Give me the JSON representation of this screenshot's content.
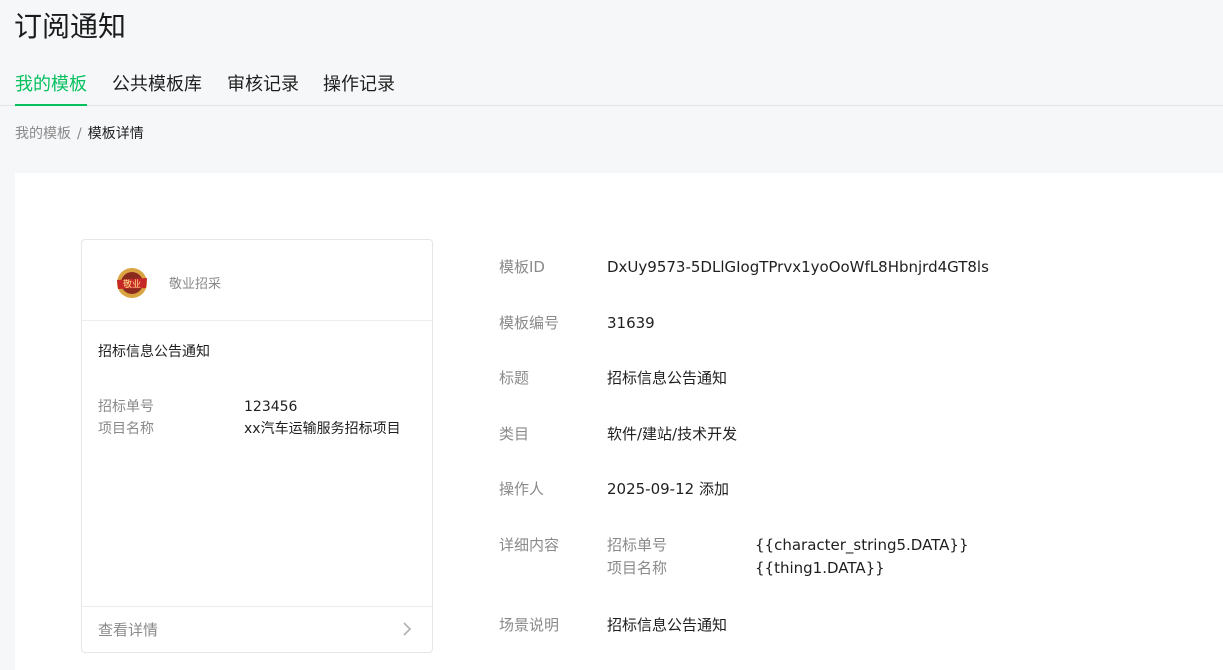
{
  "header": {
    "title": "订阅通知"
  },
  "tabs": [
    {
      "label": "我的模板",
      "active": true
    },
    {
      "label": "公共模板库",
      "active": false
    },
    {
      "label": "审核记录",
      "active": false
    },
    {
      "label": "操作记录",
      "active": false
    }
  ],
  "breadcrumb": {
    "parent": "我的模板",
    "separator": "/",
    "current": "模板详情"
  },
  "preview": {
    "brand_name": "敬业招采",
    "logo_text": "敬业",
    "title": "招标信息公告通知",
    "fields": [
      {
        "key": "招标单号",
        "value": "123456"
      },
      {
        "key": "项目名称",
        "value": "xx汽车运输服务招标项目"
      }
    ],
    "footer_label": "查看详情"
  },
  "details": {
    "template_id": {
      "label": "模板ID",
      "value": "DxUy9573-5DLlGIogTPrvx1yoOoWfL8Hbnjrd4GT8ls"
    },
    "template_no": {
      "label": "模板编号",
      "value": "31639"
    },
    "title": {
      "label": "标题",
      "value": "招标信息公告通知"
    },
    "category": {
      "label": "类目",
      "value": "软件/建站/技术开发"
    },
    "operator": {
      "label": "操作人",
      "value": "2025-09-12 添加"
    },
    "content": {
      "label": "详细内容",
      "items": [
        {
          "key": "招标单号",
          "value": "{{character_string5.DATA}}"
        },
        {
          "key": "项目名称",
          "value": "{{thing1.DATA}}"
        }
      ]
    },
    "scene": {
      "label": "场景说明",
      "value": "招标信息公告通知"
    }
  },
  "colors": {
    "accent": "#07c160",
    "muted": "#8a8a8a",
    "text": "#1f1f1f"
  },
  "icons": {
    "footer_arrow": "chevron-right-icon",
    "brand_logo": "brand-logo-icon"
  }
}
